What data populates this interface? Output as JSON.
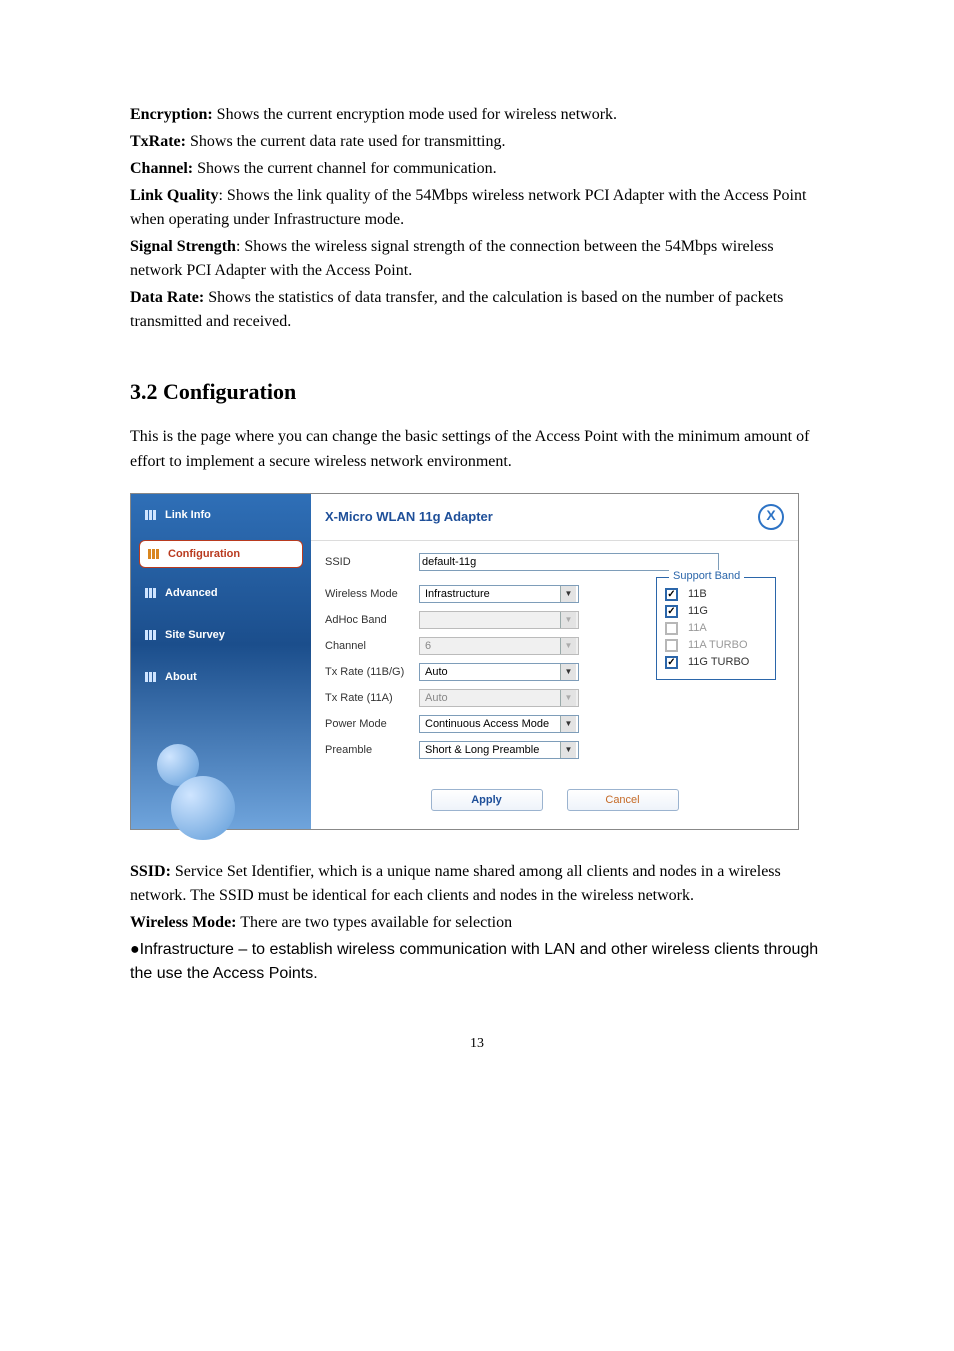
{
  "definitions": {
    "encryption": {
      "term": "Encryption:",
      "text": " Shows the current encryption mode used for wireless network."
    },
    "txrate": {
      "term": "TxRate:",
      "text": " Shows the current data rate used for transmitting."
    },
    "channel": {
      "term": "Channel:",
      "text": " Shows the current channel for communication."
    },
    "linkquality": {
      "term": "Link Quality",
      "text": ": Shows the link quality of the 54Mbps wireless network PCI Adapter with the Access Point when operating under Infrastructure mode."
    },
    "signal": {
      "term": "Signal Strength",
      "text": ": Shows the wireless signal strength of the connection between the 54Mbps wireless network PCI Adapter with the Access Point."
    },
    "datarate": {
      "term": "Data Rate:",
      "text": " Shows the statistics of data transfer, and the calculation is based on the number of packets transmitted and received."
    }
  },
  "section": {
    "heading": "3.2 Configuration",
    "intro": "This is the page where you can change the basic settings of the Access Point with the minimum amount of effort to implement a secure wireless network environment."
  },
  "dialog": {
    "title": "X-Micro WLAN 11g Adapter",
    "nav": {
      "link_info": "Link Info",
      "configuration": "Configuration",
      "advanced": "Advanced",
      "site_survey": "Site Survey",
      "about": "About"
    },
    "fields": {
      "ssid": {
        "label": "SSID",
        "value": "default-11g"
      },
      "wireless_mode": {
        "label": "Wireless Mode",
        "value": "Infrastructure"
      },
      "adhoc_band": {
        "label": "AdHoc Band",
        "value": ""
      },
      "channel": {
        "label": "Channel",
        "value": "6"
      },
      "tx_rate_bg": {
        "label": "Tx Rate (11B/G)",
        "value": "Auto"
      },
      "tx_rate_a": {
        "label": "Tx Rate (11A)",
        "value": "Auto"
      },
      "power_mode": {
        "label": "Power Mode",
        "value": "Continuous Access Mode"
      },
      "preamble": {
        "label": "Preamble",
        "value": "Short & Long Preamble"
      }
    },
    "support_band": {
      "legend": "Support Band",
      "items": [
        {
          "label": "11B",
          "checked": true,
          "disabled": false
        },
        {
          "label": "11G",
          "checked": true,
          "disabled": false
        },
        {
          "label": "11A",
          "checked": false,
          "disabled": true
        },
        {
          "label": "11A TURBO",
          "checked": false,
          "disabled": true
        },
        {
          "label": "11G TURBO",
          "checked": true,
          "disabled": false
        }
      ]
    },
    "buttons": {
      "apply": "Apply",
      "cancel": "Cancel"
    }
  },
  "post": {
    "ssid": {
      "term": "SSID:",
      "text": " Service Set Identifier, which is a unique name shared among all clients and nodes in a wireless network. The SSID must be identical for each clients and nodes in the wireless network."
    },
    "wireless_mode": {
      "term": "Wireless Mode:",
      "text": " There are two types available for selection"
    },
    "bullet_infra": "●Infrastructure – to establish wireless communication with LAN and other wireless clients through the use the Access Points."
  },
  "page_number": "13"
}
